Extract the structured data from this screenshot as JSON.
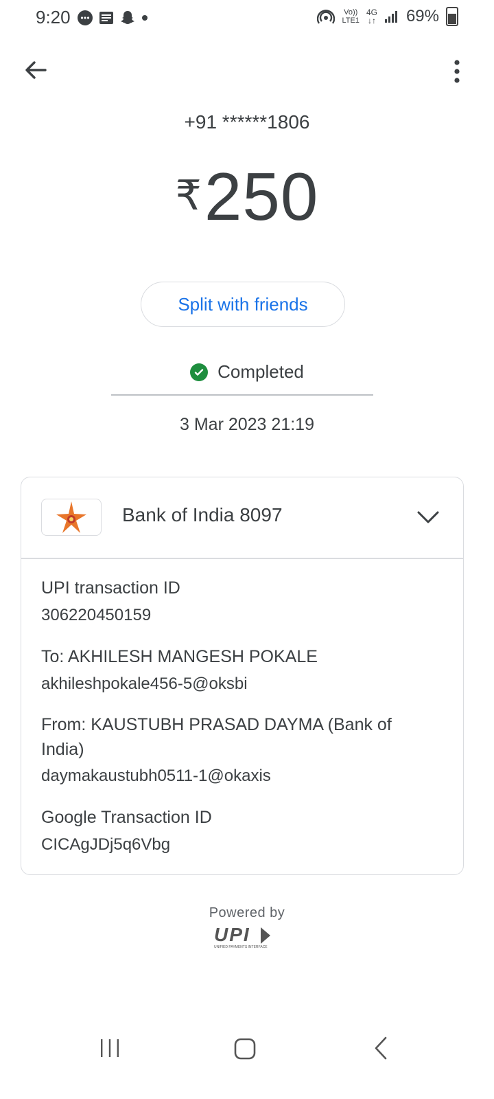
{
  "status_bar": {
    "time": "9:20",
    "network_top": "Vo))",
    "network_bottom": "LTE1",
    "signal_type": "4G",
    "battery": "69%"
  },
  "header": {
    "back_icon": "arrow-left",
    "menu_icon": "more-vertical"
  },
  "payee_phone": "+91 ******1806",
  "amount": {
    "currency": "₹",
    "value": "250"
  },
  "split_button": "Split with friends",
  "status": {
    "label": "Completed",
    "color": "#1e8e3e"
  },
  "timestamp": "3 Mar 2023 21:19",
  "bank": {
    "name": "Bank of India 8097"
  },
  "details": {
    "upi_label": "UPI transaction ID",
    "upi_value": "306220450159",
    "to_label": "To: AKHILESH MANGESH POKALE",
    "to_value": "akhileshpokale456-5@oksbi",
    "from_label": "From: KAUSTUBH PRASAD DAYMA (Bank of India)",
    "from_value": "daymakaustubh0511-1@okaxis",
    "google_label": "Google Transaction ID",
    "google_value": "CICAgJDj5q6Vbg"
  },
  "footer": {
    "powered_by": "Powered by",
    "upi_logo_text": "UPI",
    "upi_tagline": "UNIFIED PAYMENTS INTERFACE"
  },
  "colors": {
    "accent": "#1a73e8",
    "text": "#3c4043",
    "border": "#dadce0"
  }
}
